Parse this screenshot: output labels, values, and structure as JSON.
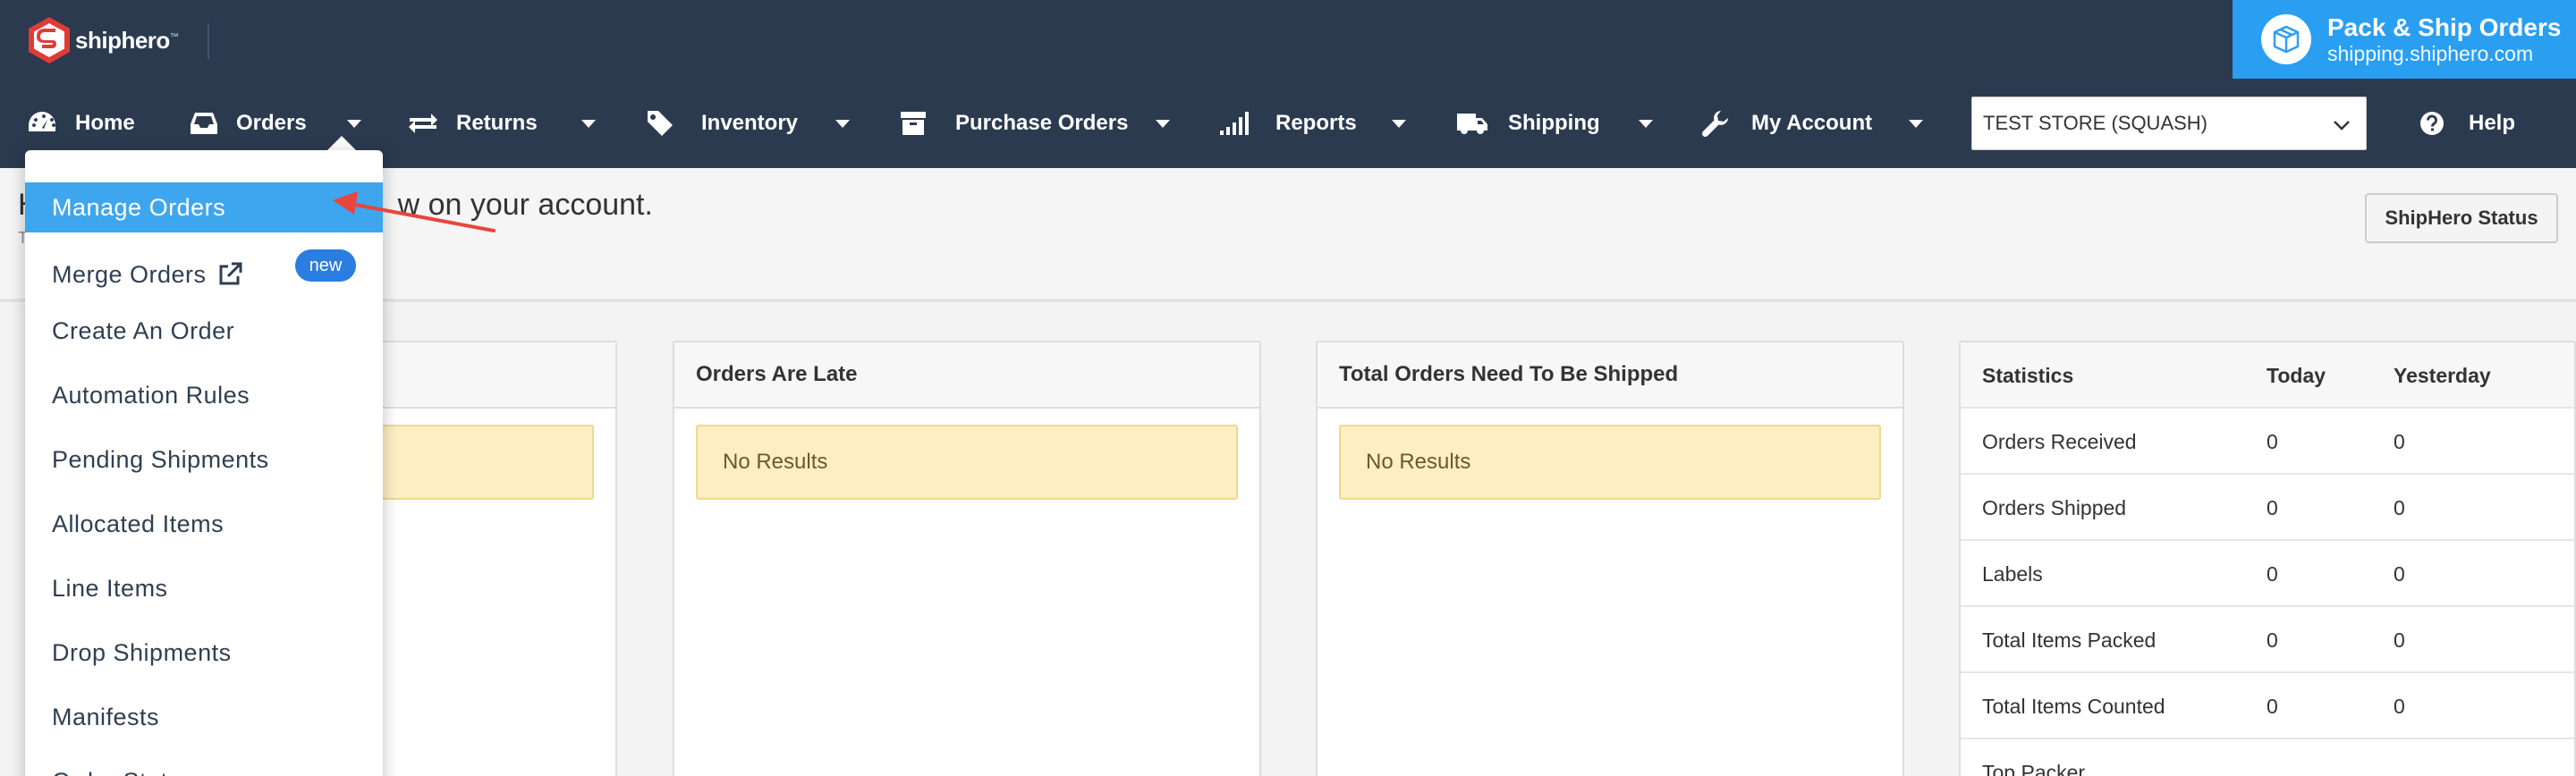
{
  "brand": {
    "logo_text": "shiphero",
    "tm": "™"
  },
  "pack_ship": {
    "title": "Pack & Ship Orders",
    "url": "shipping.shiphero.com"
  },
  "nav": {
    "home": "Home",
    "orders": "Orders",
    "returns": "Returns",
    "inventory": "Inventory",
    "purchase_orders": "Purchase Orders",
    "reports": "Reports",
    "shipping": "Shipping",
    "my_account": "My Account",
    "store": "TEST STORE (SQUASH)",
    "help": "Help"
  },
  "page": {
    "welcome_prefix": "H",
    "welcome_suffix": "w on your account.",
    "welcome_sub": "T",
    "status_button": "ShipHero Status"
  },
  "orders_menu": {
    "manage_orders": "Manage Orders",
    "merge_orders": "Merge Orders",
    "new_badge": "new",
    "create_order": "Create An Order",
    "automation_rules": "Automation Rules",
    "pending_shipments": "Pending Shipments",
    "allocated_items": "Allocated Items",
    "line_items": "Line Items",
    "drop_shipments": "Drop Shipments",
    "manifests": "Manifests",
    "order_statuses": "Order Statuses"
  },
  "panels": {
    "late": {
      "title": "Orders Are Late",
      "empty": "No Results"
    },
    "to_ship": {
      "title": "Total Orders Need To Be Shipped",
      "empty": "No Results"
    }
  },
  "statistics": {
    "headers": {
      "label": "Statistics",
      "today": "Today",
      "yesterday": "Yesterday"
    },
    "rows": [
      {
        "label": "Orders Received",
        "today": "0",
        "yesterday": "0"
      },
      {
        "label": "Orders Shipped",
        "today": "0",
        "yesterday": "0"
      },
      {
        "label": "Labels",
        "today": "0",
        "yesterday": "0"
      },
      {
        "label": "Total Items Packed",
        "today": "0",
        "yesterday": "0"
      },
      {
        "label": "Total Items Counted",
        "today": "0",
        "yesterday": "0"
      },
      {
        "label": "Top Packer",
        "today": "",
        "yesterday": ""
      }
    ]
  },
  "colors": {
    "nav_bg": "#2b3a4f",
    "accent": "#2a9ff2",
    "active_item": "#3ea6ee",
    "no_results_bg": "#fcefc4",
    "annotation_arrow": "#e8453c"
  }
}
